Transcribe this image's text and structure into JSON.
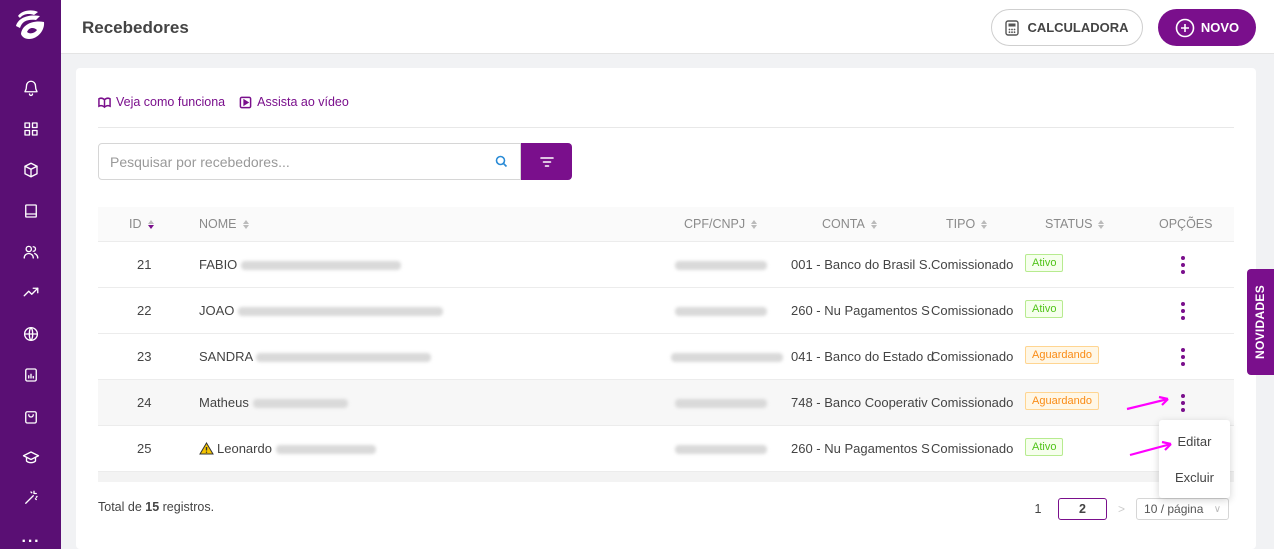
{
  "header": {
    "title": "Recebedores",
    "calc_label": "CALCULADORA",
    "new_label": "NOVO"
  },
  "help": {
    "how_it_works": "Veja como funciona",
    "watch_video": "Assista ao vídeo"
  },
  "search": {
    "placeholder": "Pesquisar por recebedores..."
  },
  "table": {
    "columns": {
      "id": "ID",
      "nome": "NOME",
      "cpf": "CPF/CNPJ",
      "conta": "CONTA",
      "tipo": "TIPO",
      "status": "STATUS",
      "opcoes": "OPÇÕES"
    },
    "rows": [
      {
        "id": "21",
        "name": "FABIO",
        "conta": "001 - Banco do Brasil S.",
        "tipo": "Comissionado",
        "status": "Ativo"
      },
      {
        "id": "22",
        "name": "JOAO",
        "conta": "260 - Nu Pagamentos S",
        "tipo": "Comissionado",
        "status": "Ativo"
      },
      {
        "id": "23",
        "name": "SANDRA",
        "conta": "041 - Banco do Estado d",
        "tipo": "Comissionado",
        "status": "Aguardando"
      },
      {
        "id": "24",
        "name": "Matheus",
        "conta": "748 - Banco Cooperativ",
        "tipo": "Comissionado",
        "status": "Aguardando"
      },
      {
        "id": "25",
        "name": "Leonardo",
        "conta": "260 - Nu Pagamentos S",
        "tipo": "Comissionado",
        "status": "Ativo"
      }
    ]
  },
  "footer": {
    "total_prefix": "Total de ",
    "total_count": "15",
    "total_suffix": " registros.",
    "pages": [
      "1",
      "2"
    ],
    "page_size": "10 / página"
  },
  "menu": {
    "edit": "Editar",
    "delete": "Excluir"
  },
  "novidades": "NOVIDADES",
  "colors": {
    "brand": "#7a0f8c",
    "sidebar": "#5a0f74",
    "annotation_arrow": "#ff00ff"
  }
}
